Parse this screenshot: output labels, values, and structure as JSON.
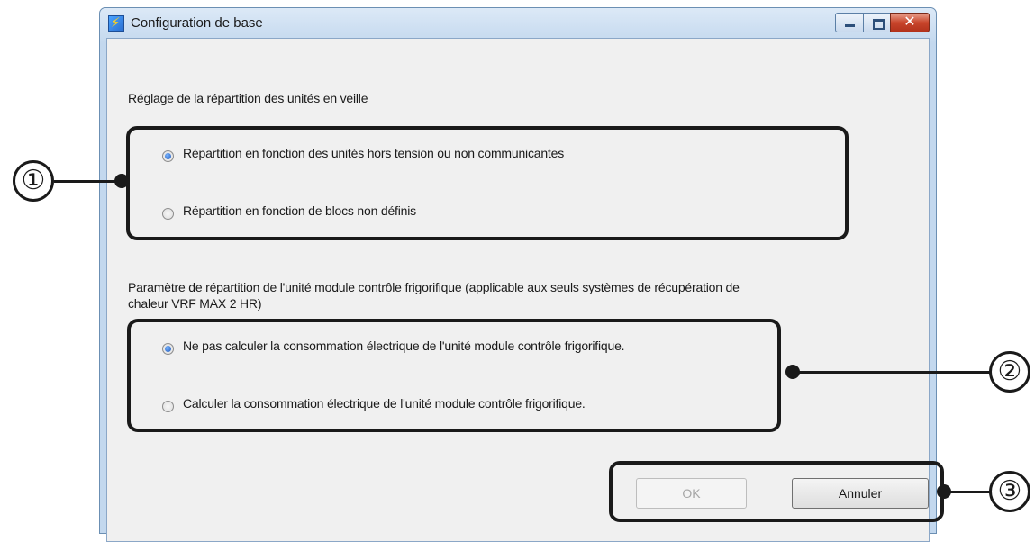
{
  "window": {
    "title": "Configuration de base",
    "icon": "app-settings-icon",
    "controls": {
      "minimize": "minimize-icon",
      "maximize": "maximize-icon",
      "close": "✕"
    }
  },
  "standby": {
    "heading": "Réglage de la répartition des unités en veille",
    "options": [
      {
        "label": "Répartition en fonction des unités hors tension ou non communicantes",
        "checked": true
      },
      {
        "label": "Répartition en fonction de blocs non définis",
        "checked": false
      }
    ]
  },
  "refrigeration": {
    "heading_line1": "Paramètre de répartition de l'unité module contrôle frigorifique (applicable aux seuls systèmes de récupération de",
    "heading_line2": "chaleur VRF MAX 2 HR)",
    "options": [
      {
        "label": "Ne pas calculer la consommation électrique de l'unité module contrôle frigorifique.",
        "checked": true
      },
      {
        "label": "Calculer la consommation électrique de l'unité module contrôle frigorifique.",
        "checked": false
      }
    ]
  },
  "buttons": {
    "ok": "OK",
    "cancel": "Annuler"
  },
  "callouts": {
    "one": "①",
    "two": "②",
    "three": "③"
  }
}
